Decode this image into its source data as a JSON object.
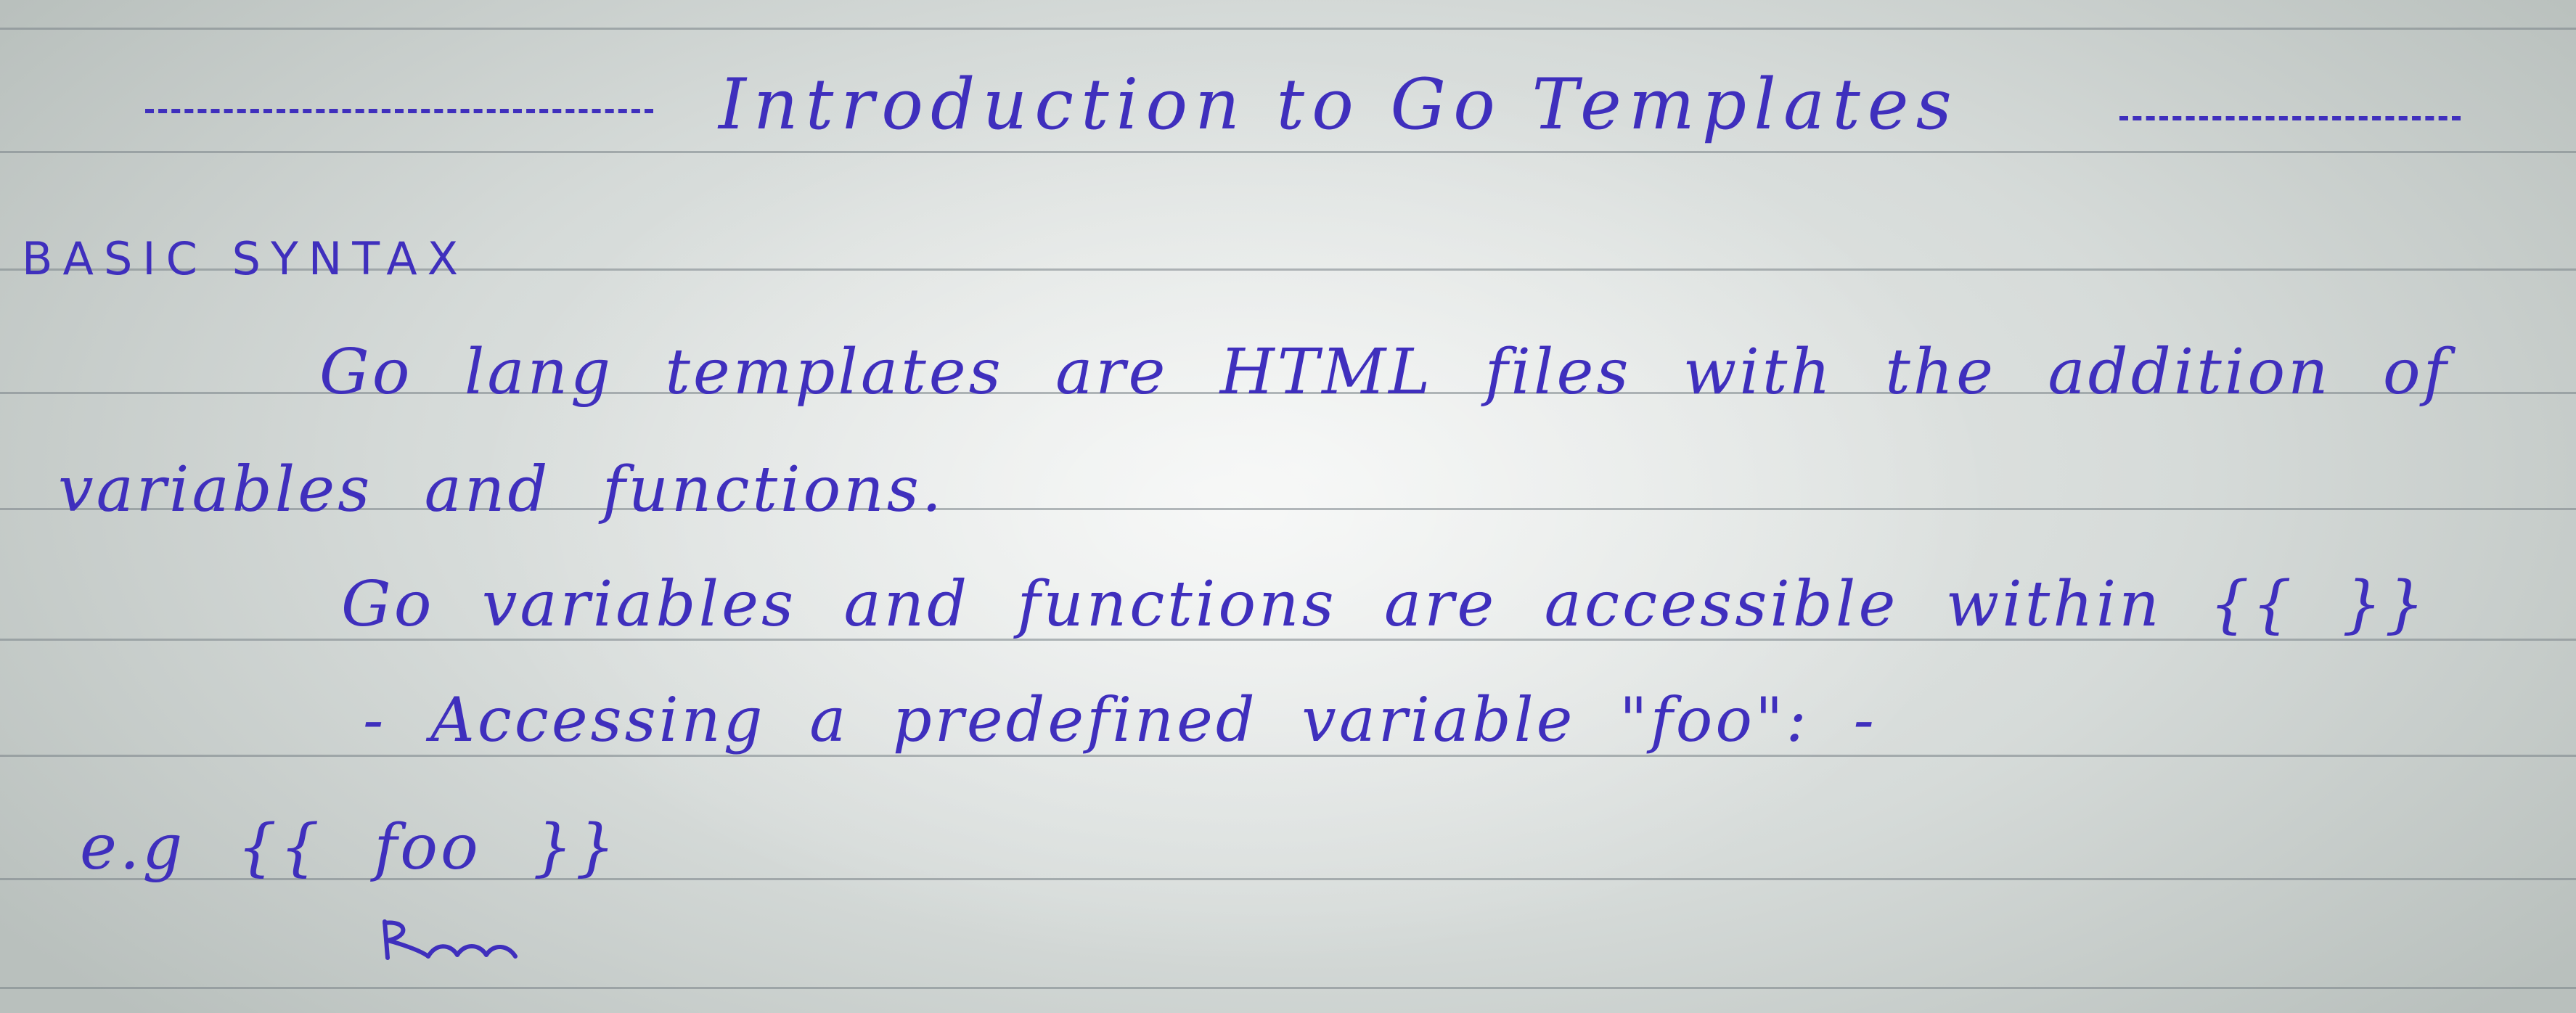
{
  "note": {
    "title": "Introduction to Go Templates",
    "heading": "BASIC SYNTAX",
    "paragraph_line1": "Go lang templates are HTML files with the addition of",
    "paragraph_line2": "variables and functions.",
    "line3": "Go variables and functions are accessible within {{ }}",
    "line4": "- Accessing a predefined variable \"foo\": -",
    "line5": "e.g {{ foo }}",
    "ink_color": "#3f2fbd"
  }
}
